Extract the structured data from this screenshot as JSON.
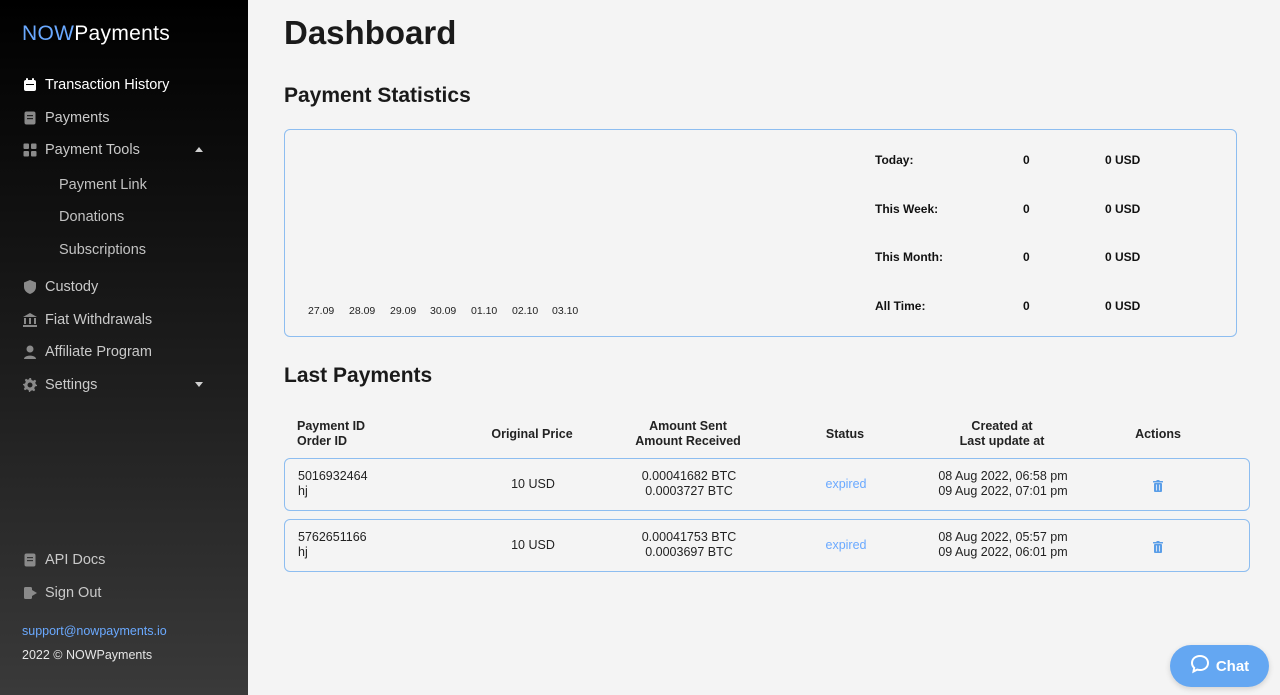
{
  "brand": {
    "now": "NOW",
    "payments": "Payments"
  },
  "sidebar": {
    "items": [
      {
        "label": "Transaction History",
        "icon": "calendar-icon",
        "active": true
      },
      {
        "label": "Payments",
        "icon": "document-icon"
      },
      {
        "label": "Payment Tools",
        "icon": "grid-icon",
        "expanded": true
      },
      {
        "label": "Custody",
        "icon": "shield-icon"
      },
      {
        "label": "Fiat Withdrawals",
        "icon": "bank-icon"
      },
      {
        "label": "Affiliate Program",
        "icon": "user-icon"
      },
      {
        "label": "Settings",
        "icon": "gear-icon",
        "expanded": false
      }
    ],
    "sub_items": [
      "Payment Link",
      "Donations",
      "Subscriptions"
    ],
    "bottom": [
      {
        "label": "API Docs",
        "icon": "book-icon"
      },
      {
        "label": "Sign Out",
        "icon": "sign-out-icon"
      }
    ],
    "support_email": "support@nowpayments.io",
    "copyright": "2022 © NOWPayments"
  },
  "page": {
    "title": "Dashboard"
  },
  "stats": {
    "heading": "Payment Statistics",
    "x_labels": [
      "27.09",
      "28.09",
      "29.09",
      "30.09",
      "01.10",
      "02.10",
      "03.10"
    ],
    "rows": [
      {
        "label": "Today:",
        "count": "0",
        "usd": "0 USD"
      },
      {
        "label": "This Week:",
        "count": "0",
        "usd": "0 USD"
      },
      {
        "label": "This Month:",
        "count": "0",
        "usd": "0 USD"
      },
      {
        "label": "All Time:",
        "count": "0",
        "usd": "0 USD"
      }
    ]
  },
  "last_payments": {
    "heading": "Last Payments",
    "headers": {
      "id_line1": "Payment ID",
      "id_line2": "Order ID",
      "price": "Original Price",
      "amount_line1": "Amount Sent",
      "amount_line2": "Amount Received",
      "status": "Status",
      "date_line1": "Created at",
      "date_line2": "Last update at",
      "actions": "Actions"
    },
    "rows": [
      {
        "payment_id": "5016932464",
        "order_id": "hj",
        "price": "10 USD",
        "sent": "0.00041682 BTC",
        "received": "0.0003727 BTC",
        "status": "expired",
        "created": "08 Aug 2022, 06:58 pm",
        "updated": "09 Aug 2022, 07:01 pm"
      },
      {
        "payment_id": "5762651166",
        "order_id": "hj",
        "price": "10 USD",
        "sent": "0.00041753 BTC",
        "received": "0.0003697 BTC",
        "status": "expired",
        "created": "08 Aug 2022, 05:57 pm",
        "updated": "09 Aug 2022, 06:01 pm"
      }
    ]
  },
  "chat": {
    "label": "Chat"
  },
  "colors": {
    "accent": "#6aa9ff",
    "border": "#8dbdf0",
    "chat_bg": "#64a7f2"
  }
}
